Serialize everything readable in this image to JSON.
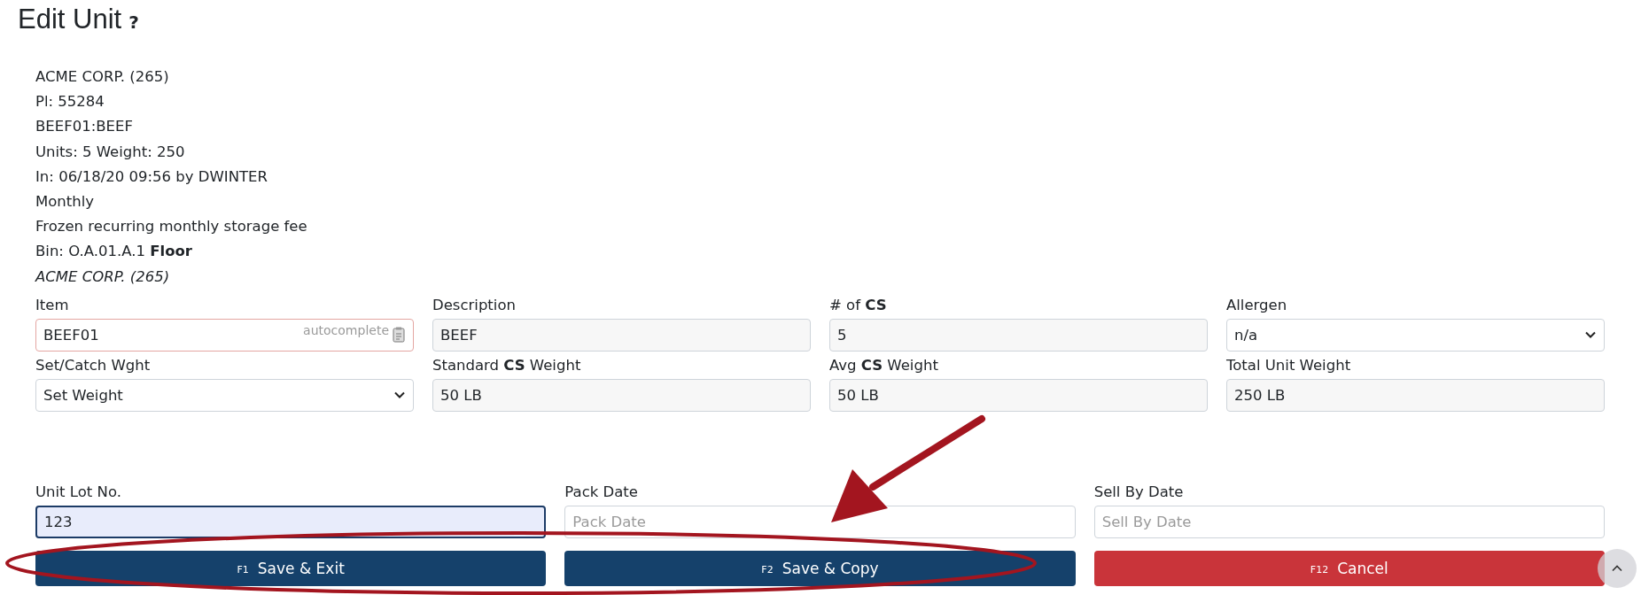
{
  "title": "Edit Unit",
  "help": "?",
  "info_lines": [
    {
      "text": "ACME CORP. (265)",
      "italic": false
    },
    {
      "text": "Pl: 55284",
      "italic": false
    },
    {
      "text": "BEEF01:BEEF",
      "italic": false
    },
    {
      "text": "Units: 5 Weight: 250",
      "italic": false
    },
    {
      "text": "In: 06/18/20 09:56 by DWINTER",
      "italic": false
    },
    {
      "text": "Monthly",
      "italic": false
    },
    {
      "text": "Frozen recurring monthly storage fee",
      "italic": false
    },
    {
      "text": "Bin: O.A.01.A.1 **Floor**",
      "italic": false
    },
    {
      "text": "ACME CORP. (265)",
      "italic": true
    }
  ],
  "field_rows": [
    [
      {
        "label": "Item",
        "kind": "input",
        "value": "BEEF01",
        "invalid": true,
        "autocomplete": "autocomplete"
      },
      {
        "label": "Description",
        "kind": "readonly",
        "value": "BEEF"
      },
      {
        "label": "# of **CS**",
        "kind": "readonly",
        "value": "5"
      },
      {
        "label": "Allergen",
        "kind": "select",
        "value": "n/a"
      }
    ],
    [
      {
        "label": "Set/Catch Wght",
        "kind": "select",
        "value": "Set Weight"
      },
      {
        "label": "Standard **CS** Weight",
        "kind": "readonly",
        "value": "50 LB"
      },
      {
        "label": "Avg **CS** Weight",
        "kind": "readonly",
        "value": "50 LB"
      },
      {
        "label": "Total Unit Weight",
        "kind": "readonly",
        "value": "250 LB"
      }
    ]
  ],
  "lot_row": [
    {
      "label": "Unit Lot No.",
      "kind": "input",
      "value": "123",
      "focused": true
    },
    {
      "label": "Pack Date",
      "kind": "input",
      "placeholder": "Pack Date",
      "focused": false
    },
    {
      "label": "Sell By Date",
      "kind": "input",
      "placeholder": "Sell By Date",
      "focused": false
    }
  ],
  "buttons": [
    {
      "key": "F1",
      "label": "Save & Exit",
      "kind": "primary"
    },
    {
      "key": "F2",
      "label": "Save & Copy",
      "kind": "primary"
    },
    {
      "key": "F12",
      "label": "Cancel",
      "kind": "danger"
    }
  ],
  "highlight": {
    "kind": "ellipse"
  },
  "pointer": {
    "kind": "arrow"
  }
}
